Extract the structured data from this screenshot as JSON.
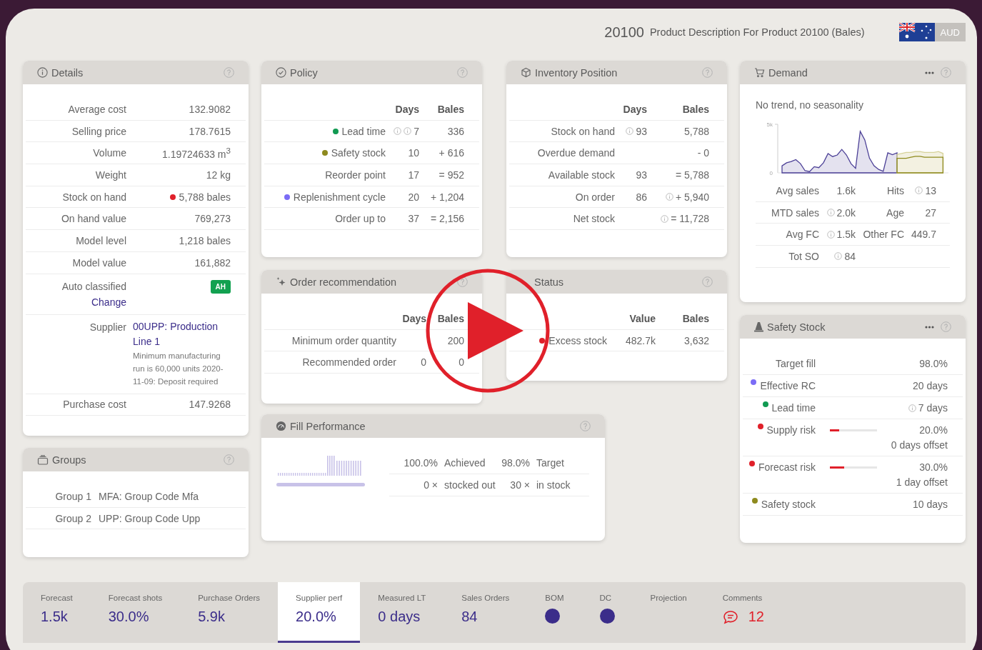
{
  "header": {
    "code": "20100",
    "description": "Product Description For Product 20100 (Bales)",
    "currency": "AUD"
  },
  "details": {
    "title": "Details",
    "rows": [
      {
        "kind": "value",
        "label": "Average cost",
        "value": "132.9082"
      },
      {
        "kind": "value",
        "label": "Selling price",
        "value": "178.7615"
      },
      {
        "kind": "value",
        "label": "Volume",
        "value": "1.19724633 m$^{3}$"
      },
      {
        "kind": "value",
        "label": "Weight",
        "value": "12 kg"
      },
      {
        "kind": "value",
        "label": "Stock on hand",
        "value": "5,788 bales",
        "color": "#e0202a"
      },
      {
        "kind": "value",
        "label": "On hand value",
        "value": "769,273"
      },
      {
        "kind": "value",
        "label": "Model level",
        "value": "1,218 bales"
      },
      {
        "kind": "value",
        "label": "Model value",
        "value": "161,882"
      },
      {
        "kind": "badge",
        "label": "Auto classified",
        "link": "Change",
        "badge": "AH"
      },
      {
        "kind": "supplier",
        "label": "Supplier",
        "link": "00UPP: Production Line 1",
        "note": "Minimum manufacturing run is 60,000 units 2020-11-09: Deposit required"
      },
      {
        "kind": "value",
        "label": "Purchase cost",
        "value": "147.9268"
      }
    ]
  },
  "groups": {
    "title": "Groups",
    "rows": [
      {
        "label": "Group 1",
        "value": "MFA: Group Code Mfa"
      },
      {
        "label": "Group 2",
        "value": "UPP: Group Code Upp"
      }
    ]
  },
  "policy": {
    "title": "Policy",
    "columns": [
      "Days",
      "Bales"
    ],
    "rows": [
      {
        "label": "Lead time",
        "color": "#119a52",
        "cells": [
          {
            "text": "7",
            "info": true,
            "extra_info": true
          },
          {
            "text": "336"
          }
        ]
      },
      {
        "label": "Safety stock",
        "color": "#8e8a1e",
        "cells": [
          {
            "text": "10"
          },
          {
            "text": "+ 616"
          }
        ]
      },
      {
        "label": "Reorder point",
        "cells": [
          {
            "text": "17"
          },
          {
            "text": "= 952"
          }
        ]
      },
      {
        "label": "Replenishment cycle",
        "color": "#7b6cf6",
        "cells": [
          {
            "text": "20"
          },
          {
            "text": "+ 1,204"
          }
        ]
      },
      {
        "label": "Order up to",
        "cells": [
          {
            "text": "37"
          },
          {
            "text": "= 2,156"
          }
        ]
      }
    ]
  },
  "inventory_position": {
    "title": "Inventory Position",
    "columns": [
      "Days",
      "Bales"
    ],
    "rows": [
      {
        "label": "Stock on hand",
        "cells": [
          {
            "text": "93",
            "info": true
          },
          {
            "text": "5,788"
          }
        ]
      },
      {
        "label": "Overdue demand",
        "cells": [
          null,
          {
            "text": "- 0"
          }
        ]
      },
      {
        "label": "Available stock",
        "cells": [
          {
            "text": "93"
          },
          {
            "text": "= 5,788"
          }
        ]
      },
      {
        "label": "On order",
        "cells": [
          {
            "text": "86"
          },
          {
            "text": "+ 5,940",
            "info": true
          }
        ]
      },
      {
        "label": "Net stock",
        "cells": [
          null,
          {
            "text": "= 11,728",
            "info": true
          }
        ]
      }
    ]
  },
  "order_recommendation": {
    "title": "Order recommendation",
    "columns": [
      "Days",
      "Bales"
    ],
    "rows": [
      {
        "label": "Minimum order quantity",
        "cells": [
          null,
          {
            "text": "200"
          }
        ]
      },
      {
        "label": "Recommended order",
        "cells": [
          {
            "text": "0"
          },
          {
            "text": "0"
          }
        ]
      }
    ]
  },
  "status": {
    "title": "Status",
    "columns": [
      "Value",
      "Bales"
    ],
    "rows": [
      {
        "label": "Excess stock",
        "color": "#e0202a",
        "cells": [
          {
            "text": "482.7k"
          },
          {
            "text": "3,632"
          }
        ]
      }
    ]
  },
  "fill_performance": {
    "title": "Fill Performance",
    "rows": [
      [
        "100.0%",
        "Achieved",
        "98.0%",
        "Target"
      ],
      [
        "0 ×",
        "stocked out",
        "30 ×",
        "in stock"
      ]
    ]
  },
  "demand": {
    "title": "Demand",
    "subtitle": "No trend, no seasonality",
    "chart_axis_labels": [
      "5k",
      "0"
    ],
    "stats": [
      [
        {
          "label": "Avg sales",
          "value": "1.6k"
        },
        {
          "label": "Hits",
          "value": "13",
          "info": true
        }
      ],
      [
        {
          "label": "MTD sales",
          "value": "2.0k",
          "info": true
        },
        {
          "label": "Age",
          "value": "27"
        }
      ],
      [
        {
          "label": "Avg FC",
          "value": "1.5k",
          "info": true
        },
        {
          "label": "Other FC",
          "value": "449.7"
        }
      ],
      [
        {
          "label": "Tot SO",
          "value": "84",
          "info": true
        }
      ]
    ]
  },
  "safety_stock": {
    "title": "Safety Stock",
    "rows": [
      {
        "label": "Target fill",
        "value": "98.0%"
      },
      {
        "label": "Effective RC",
        "color": "#7b6cf6",
        "value": "20 days"
      },
      {
        "label": "Lead time",
        "color": "#119a52",
        "value": "7 days",
        "info": true
      },
      {
        "label": "Supply risk",
        "color": "#e0202a",
        "level": 0.2,
        "value": "20.0%",
        "note": "0 days offset"
      },
      {
        "label": "Forecast risk",
        "color": "#e0202a",
        "level": 0.3,
        "value": "30.0%",
        "note": "1 day offset"
      },
      {
        "label": "Safety stock",
        "color": "#8e8a1e",
        "value": "10 days"
      }
    ]
  },
  "bottom_tabs": [
    {
      "kind": "value",
      "label": "Forecast",
      "value": "1.5k",
      "selected": false
    },
    {
      "kind": "value",
      "label": "Forecast shots",
      "value": "30.0%",
      "selected": false
    },
    {
      "kind": "value",
      "label": "Purchase Orders",
      "value": "5.9k",
      "selected": false
    },
    {
      "kind": "value",
      "label": "Supplier perf",
      "value": "20.0%",
      "selected": true
    },
    {
      "kind": "value",
      "label": "Measured LT",
      "value": "0 days",
      "selected": false
    },
    {
      "kind": "value",
      "label": "Sales Orders",
      "value": "84",
      "selected": false
    },
    {
      "kind": "dot",
      "label": "BOM",
      "selected": false
    },
    {
      "kind": "dot",
      "label": "DC",
      "selected": false
    },
    {
      "kind": "empty",
      "label": "Projection",
      "selected": false
    },
    {
      "kind": "comments",
      "label": "Comments",
      "value": "12",
      "selected": false
    }
  ]
}
